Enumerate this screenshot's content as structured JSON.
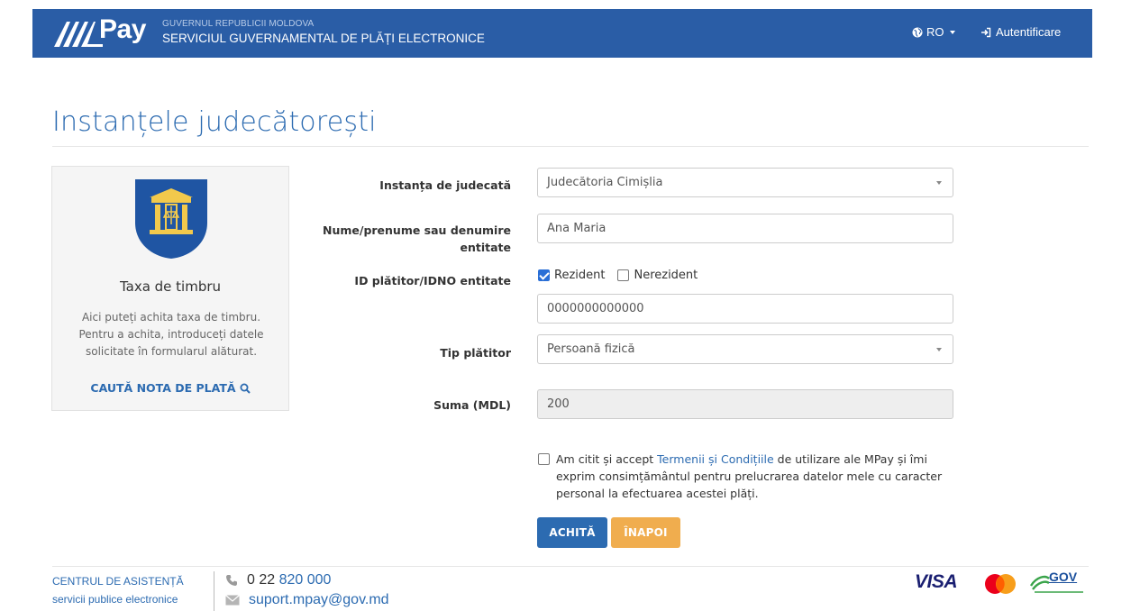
{
  "header": {
    "logo_text": "Pay",
    "gov_line": "GUVERNUL REPUBLICII MOLDOVA",
    "service_line": "SERVICIUL GUVERNAMENTAL DE PLĂȚI ELECTRONICE",
    "language": "RO",
    "login_label": "Autentificare",
    "bg_color": "#2a5da6"
  },
  "page": {
    "title": "Instanțele judecătorești"
  },
  "card": {
    "title": "Taxa de timbru",
    "description": "Aici puteți achita taxa de timbru. Pentru a achita, introduceți datele solicitate în formularul alăturat.",
    "link_label": "CAUTĂ NOTA DE PLATĂ",
    "icon": "magnifier-icon"
  },
  "form": {
    "court_label": "Instanța de judecată",
    "court_value": "Judecătoria Cimișlia",
    "name_label_line1": "Nume/prenume sau denumire",
    "name_label_line2": "entitate",
    "name_value": "Ana Maria",
    "id_label": "ID plătitor/IDNO entitate",
    "resident_label": "Rezident",
    "resident_checked": true,
    "nonresident_label": "Nerezident",
    "nonresident_checked": false,
    "id_value": "0000000000000",
    "payer_type_label": "Tip plătitor",
    "payer_type_value": "Persoană fizică",
    "amount_label": "Suma (MDL)",
    "amount_value": "200",
    "terms_before": "Am citit și accept ",
    "terms_link": "Termenii și Condițiile",
    "terms_after": " de utilizare ale MPay și îmi exprim consimțământul pentru prelucrarea datelor mele cu caracter personal la efectuarea acestei plăți.",
    "terms_checked": false,
    "pay_button": "ACHITĂ",
    "back_button": "ÎNAPOI"
  },
  "footer": {
    "center_line1": "CENTRUL DE ASISTENȚĂ",
    "center_line2": "servicii publice electronice",
    "phone_prefix": "0 22 ",
    "phone_number": "820 000",
    "email": "suport.mpay@gov.md",
    "visa_label": "VISA",
    "mgov_label": "GOV"
  }
}
